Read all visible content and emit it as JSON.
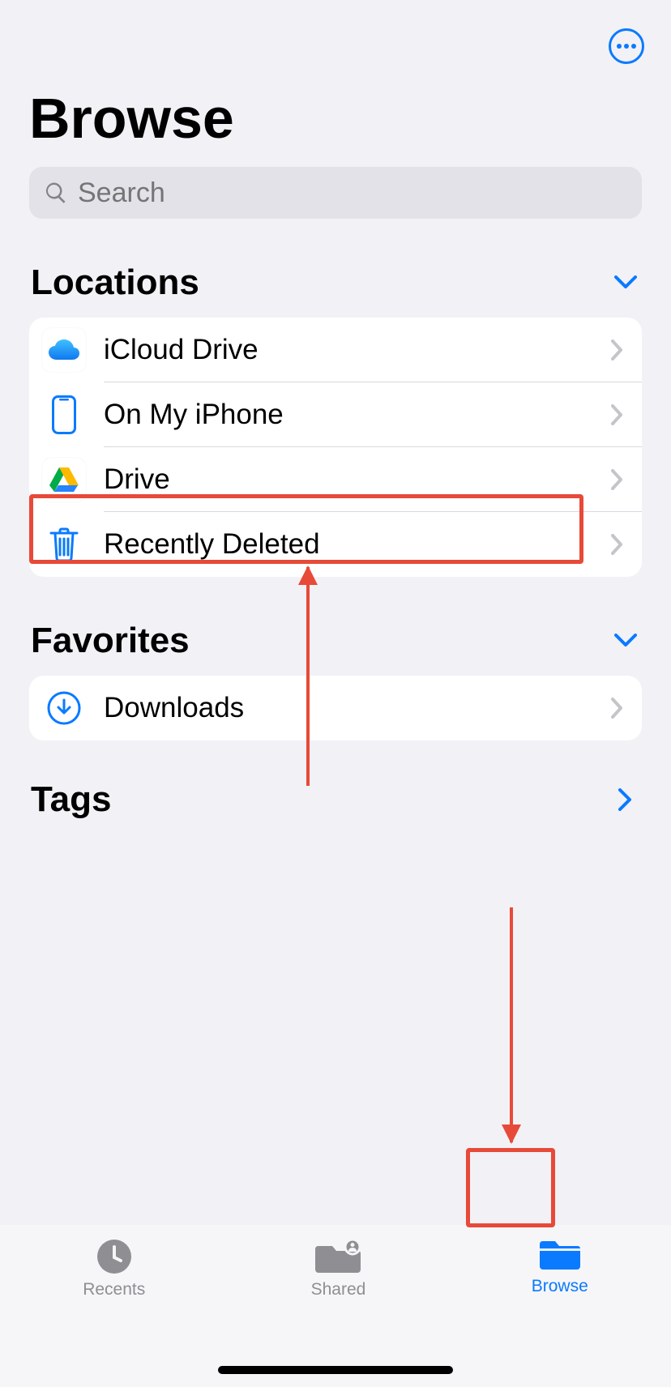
{
  "header": {
    "title": "Browse"
  },
  "search": {
    "placeholder": "Search"
  },
  "sections": {
    "locations": {
      "title": "Locations",
      "items": [
        {
          "label": "iCloud Drive"
        },
        {
          "label": "On My iPhone"
        },
        {
          "label": "Drive"
        },
        {
          "label": "Recently Deleted"
        }
      ]
    },
    "favorites": {
      "title": "Favorites",
      "items": [
        {
          "label": "Downloads"
        }
      ]
    },
    "tags": {
      "title": "Tags"
    }
  },
  "tabs": {
    "recents": "Recents",
    "shared": "Shared",
    "browse": "Browse"
  },
  "colors": {
    "accent": "#0a7aff",
    "highlight": "#e74a38"
  }
}
